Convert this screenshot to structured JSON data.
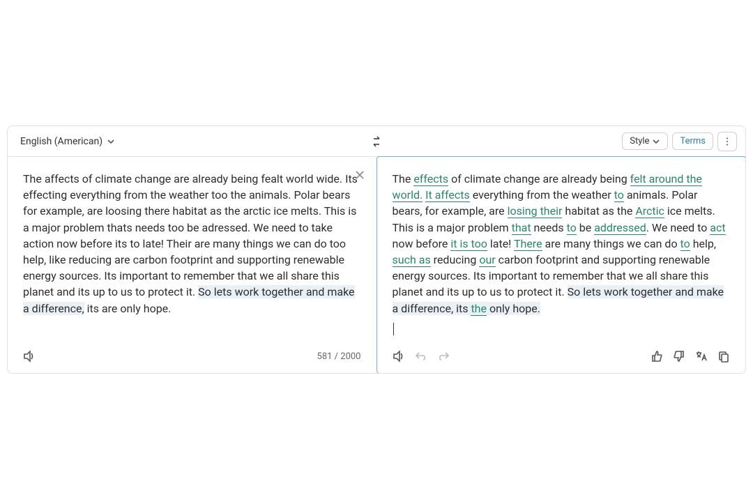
{
  "topbar": {
    "language": "English (American)",
    "style_label": "Style",
    "terms_label": "Terms"
  },
  "input": {
    "segments": [
      {
        "t": "The affects of climate change are already being fealt world wide.  Its effecting everything from the weather too the animals.  Polar bears for example, are loosing there habitat as the arctic ice melts.  This is a  major problem thats needs too be adressed.  We need to take action now before its to late!  Their are many things we can do too help, like reducing are carbon footprint and supporting renewable energy sources.  Its important to remember that we all share this planet and its up to us to protect it.  "
      },
      {
        "t": "So lets work together and make a difference,",
        "sel": true
      },
      {
        "t": "  its are only hope."
      }
    ],
    "count": "581 / 2000"
  },
  "output": {
    "segments": [
      {
        "t": "The "
      },
      {
        "t": "effects",
        "hl": true
      },
      {
        "t": " of climate change are already being "
      },
      {
        "t": "felt around the world.",
        "hl": true
      },
      {
        "t": "  "
      },
      {
        "t": "It affects",
        "hl": true
      },
      {
        "t": " everything from the weather "
      },
      {
        "t": "to",
        "hl": true
      },
      {
        "t": " animals.  Polar bears, for example, are "
      },
      {
        "t": "losing their",
        "hl": true
      },
      {
        "t": " habitat as the "
      },
      {
        "t": "Arctic",
        "hl": true
      },
      {
        "t": " ice melts.  This is a major problem "
      },
      {
        "t": "that",
        "hl": true
      },
      {
        "t": " needs "
      },
      {
        "t": "to",
        "hl": true
      },
      {
        "t": " be "
      },
      {
        "t": "addressed",
        "hl": true
      },
      {
        "t": ".  We need to "
      },
      {
        "t": "act",
        "hl": true
      },
      {
        "t": " now before "
      },
      {
        "t": "it is too",
        "hl": true
      },
      {
        "t": " late!  "
      },
      {
        "t": "There",
        "hl": true
      },
      {
        "t": " are many things we can do "
      },
      {
        "t": "to",
        "hl": true
      },
      {
        "t": " help, "
      },
      {
        "t": "such as",
        "hl": true
      },
      {
        "t": " reducing "
      },
      {
        "t": "our",
        "hl": true
      },
      {
        "t": " carbon footprint and supporting renewable energy sources.  Its important to remember that we all share this planet and its up to us to protect it.  "
      },
      {
        "t": "So lets work together and make a difference, its ",
        "sel": true
      },
      {
        "t": "the",
        "hl": true,
        "sel": true
      },
      {
        "t": " only hope.",
        "sel": true
      }
    ]
  }
}
